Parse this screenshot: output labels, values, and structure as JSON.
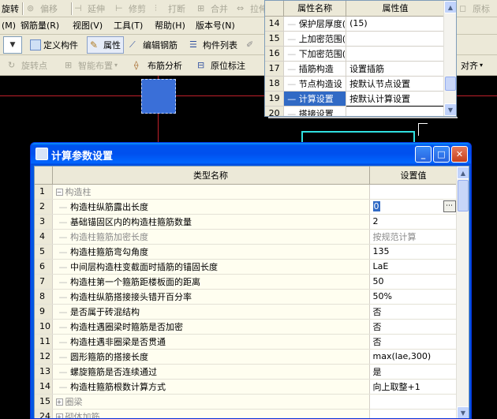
{
  "toolbar1": {
    "rotate": "旋转",
    "offset": "偏移",
    "extend": "延伸",
    "trim": "修剪",
    "break": "打断",
    "merge": "合并",
    "stretch": "拉伸",
    "origin": "原标"
  },
  "menubar": {
    "m": "(M)",
    "rebar": "钢筋量(R)",
    "view": "视图(V)",
    "tools": "工具(T)",
    "help": "帮助(H)",
    "version": "版本号(N)"
  },
  "toolbar2": {
    "define": "定义构件",
    "properties": "属性",
    "edit_rebar": "编辑钢筋",
    "component_list": "构件列表"
  },
  "toolbar3": {
    "rotate_point": "旋转点",
    "smart_layout": "智能布置",
    "layout_analysis": "布筋分析",
    "annotate": "原位标注",
    "align": "对齐"
  },
  "property_panel": {
    "col_name": "属性名称",
    "col_value": "属性值",
    "rows": [
      {
        "num": "14",
        "name": "保护层厚度(",
        "value": "(15)",
        "selected": false
      },
      {
        "num": "15",
        "name": "上加密范围(",
        "value": "",
        "selected": false
      },
      {
        "num": "16",
        "name": "下加密范围(",
        "value": "",
        "selected": false
      },
      {
        "num": "17",
        "name": "插筋构造",
        "value": "设置插筋",
        "selected": false
      },
      {
        "num": "18",
        "name": "节点构造设",
        "value": "按默认节点设置",
        "selected": false
      },
      {
        "num": "19",
        "name": "计算设置",
        "value": "按默认计算设置",
        "selected": true
      },
      {
        "num": "20",
        "name": "搭接设置",
        "value": "",
        "selected": false
      }
    ]
  },
  "dialog": {
    "title": "计算参数设置",
    "col_name": "类型名称",
    "col_value": "设置值",
    "rows": [
      {
        "num": "1",
        "name": "构造柱",
        "value": "",
        "level": 0,
        "expander": "−",
        "dim": true
      },
      {
        "num": "2",
        "name": "构造柱纵筋露出长度",
        "value": "0",
        "level": 1,
        "dim": false,
        "editing": true
      },
      {
        "num": "3",
        "name": "基础锚固区内的构造柱箍筋数量",
        "value": "2",
        "level": 1,
        "dim": false
      },
      {
        "num": "4",
        "name": "构造柱箍筋加密长度",
        "value": "按规范计算",
        "level": 1,
        "dim": true
      },
      {
        "num": "5",
        "name": "构造柱箍筋弯勾角度",
        "value": "135",
        "level": 1,
        "dim": false
      },
      {
        "num": "6",
        "name": "中间层构造柱变截面时插筋的锚固长度",
        "value": "LaE",
        "level": 1,
        "dim": false
      },
      {
        "num": "7",
        "name": "构造柱第一个箍筋距楼板面的距离",
        "value": "50",
        "level": 1,
        "dim": false
      },
      {
        "num": "8",
        "name": "构造柱纵筋搭接接头错开百分率",
        "value": "50%",
        "level": 1,
        "dim": false
      },
      {
        "num": "9",
        "name": "是否属于砖混结构",
        "value": "否",
        "level": 1,
        "dim": false
      },
      {
        "num": "10",
        "name": "构造柱遇圈梁时箍筋是否加密",
        "value": "否",
        "level": 1,
        "dim": false
      },
      {
        "num": "11",
        "name": "构造柱遇非圈梁是否贯通",
        "value": "否",
        "level": 1,
        "dim": false
      },
      {
        "num": "12",
        "name": "圆形箍筋的搭接长度",
        "value": "max(lae,300)",
        "level": 1,
        "dim": false
      },
      {
        "num": "13",
        "name": "螺旋箍筋是否连续通过",
        "value": "是",
        "level": 1,
        "dim": false
      },
      {
        "num": "14",
        "name": "构造柱箍筋根数计算方式",
        "value": "向上取整+1",
        "level": 1,
        "dim": false
      },
      {
        "num": "15",
        "name": "圈梁",
        "value": "",
        "level": 0,
        "expander": "+",
        "dim": true
      },
      {
        "num": "24",
        "name": "砌体加筋",
        "value": "",
        "level": 0,
        "expander": "+",
        "dim": true
      }
    ]
  },
  "colors": {
    "canvas": "#000000",
    "selected_row": "#316ac5",
    "title_blue": "#0054e3",
    "shape_fill": "#3a6fd8"
  }
}
